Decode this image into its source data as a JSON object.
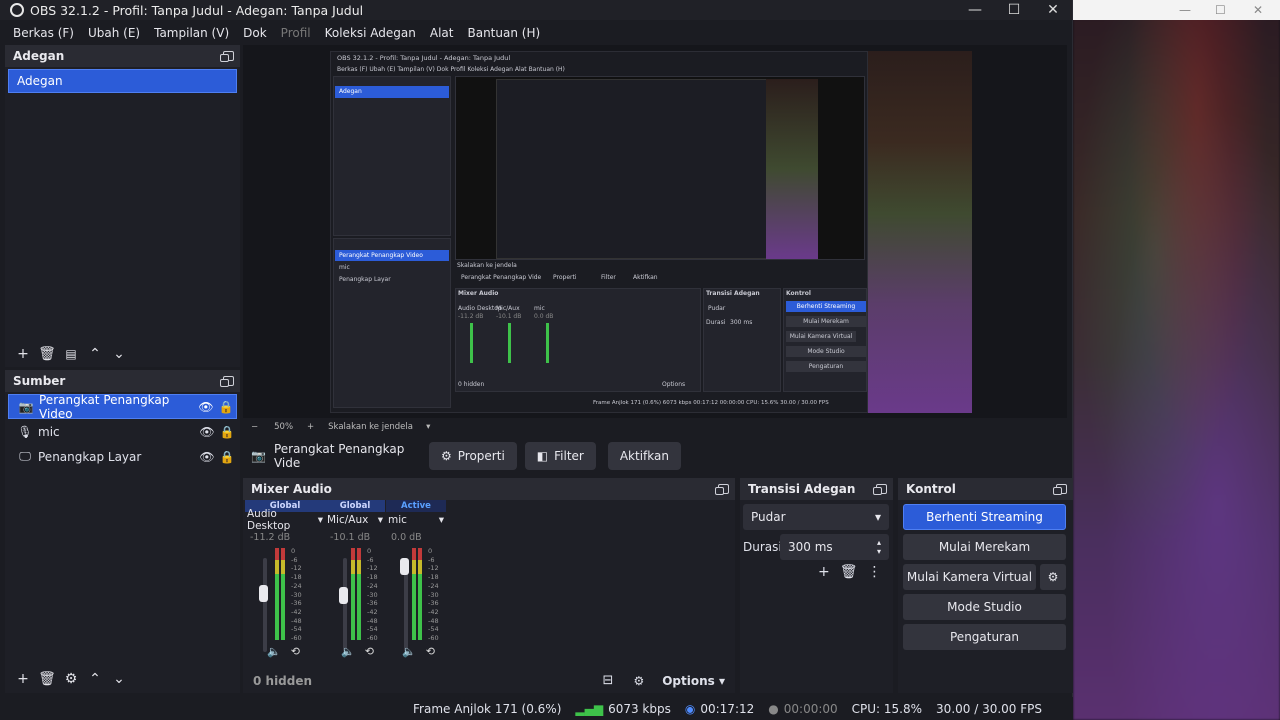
{
  "window": {
    "title": "OBS 32.1.2 - Profil: Tanpa Judul - Adegan: Tanpa Judul",
    "minimize": "—",
    "maximize": "☐",
    "close": "✕"
  },
  "menu": [
    "Berkas (F)",
    "Ubah (E)",
    "Tampilan (V)",
    "Dok",
    "Profil",
    "Koleksi Adegan",
    "Alat",
    "Bantuan (H)"
  ],
  "scenes": {
    "title": "Adegan",
    "items": [
      "Adegan"
    ]
  },
  "sources": {
    "title": "Sumber",
    "items": [
      {
        "label": "Perangkat Penangkap Video",
        "icon": "camera-icon",
        "selected": true
      },
      {
        "label": "mic",
        "icon": "microphone-icon",
        "selected": false
      },
      {
        "label": "Penangkap Layar",
        "icon": "monitor-icon",
        "selected": false
      }
    ]
  },
  "preview": {
    "zoom": "50%",
    "scale_mode": "Skalakan ke jendela",
    "zoom_minus": "−",
    "zoom_plus": "+"
  },
  "context": {
    "source_name": "Perangkat Penangkap Vide",
    "properties": "Properti",
    "filters": "Filter",
    "activate": "Aktifkan"
  },
  "mixer": {
    "title": "Mixer Audio",
    "channels": [
      {
        "tag": "Global",
        "name": "Audio Desktop",
        "db": "-11.2 dB",
        "level": 0.66
      },
      {
        "tag": "Global",
        "name": "Mic/Aux",
        "db": "-10.1 dB",
        "level": 0.64
      },
      {
        "tag": "Active",
        "name": "mic",
        "db": "0.0 dB",
        "level": 1.0
      }
    ],
    "ticks": [
      "0",
      "-6",
      "-12",
      "-18",
      "-24",
      "-30",
      "-36",
      "-42",
      "-48",
      "-54",
      "-60"
    ],
    "hidden": "0 hidden",
    "options": "Options"
  },
  "transition": {
    "title": "Transisi Adegan",
    "type": "Pudar",
    "duration_label": "Durasi",
    "duration": "300 ms"
  },
  "controls": {
    "title": "Kontrol",
    "stop_streaming": "Berhenti Streaming",
    "start_recording": "Mulai Merekam",
    "start_virtual_cam": "Mulai Kamera Virtual",
    "studio_mode": "Mode Studio",
    "settings": "Pengaturan"
  },
  "status": {
    "dropped_frames": "Frame Anjlok 171 (0.6%)",
    "bitrate": "6073 kbps",
    "stream_time": "00:17:12",
    "record_time": "00:00:00",
    "cpu": "CPU: 15.8%",
    "fps": "30.00 / 30.00 FPS"
  },
  "colors": {
    "accent": "#2c5cd8",
    "meter_green": "#3ec24a",
    "meter_yellow": "#c6b92a",
    "meter_red": "#c23a3a"
  },
  "nested": {
    "title": "OBS 32.1.2 - Profil: Tanpa Judul - Adegan: Tanpa Judul",
    "menu": "Berkas (F)   Ubah (E)   Tampilan (V)   Dok   Profil   Koleksi Adegan   Alat   Bantuan (H)",
    "scene_item": "Adegan",
    "src1": "Perangkat Penangkap Video",
    "src2": "mic",
    "src3": "Penangkap Layar",
    "ctx": "Perangkat Penangkap Vide",
    "props": "Properti",
    "filter": "Filter",
    "activate": "Aktifkan",
    "mixer": "Mixer Audio",
    "trans": "Transisi Adegan",
    "ctrl": "Kontrol",
    "b1": "Berhenti Streaming",
    "b2": "Mulai Merekam",
    "b3": "Mulai Kamera Virtual",
    "b4": "Mode Studio",
    "b5": "Pengaturan",
    "pudar": "Pudar",
    "durasi": "Durasi",
    "ms": "300 ms",
    "hidden": "0 hidden",
    "options": "Options",
    "status": "Frame Anjlok 171 (0.6%)   6073 kbps   00:17:12   00:00:00   CPU: 15.6%   30.00 / 30.00 FPS",
    "zoom": "Skalakan ke jendela",
    "audio": "Audio Desktop",
    "micaux": "Mic/Aux",
    "mic": "mic",
    "db1": "-11.2 dB",
    "db2": "-10.1 dB",
    "db3": "0.0 dB"
  }
}
